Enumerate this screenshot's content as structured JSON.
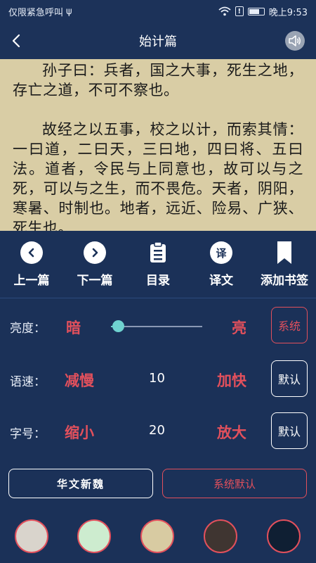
{
  "status_bar": {
    "carrier": "仅限紧急呼叫",
    "usb": "ψ",
    "signal": "!",
    "time": "晚上9:53"
  },
  "nav": {
    "title": "始计篇"
  },
  "text": {
    "paragraphs": [
      "孙子曰：兵者，国之大事，死生之地，存亡之道，不可不察也。",
      "故经之以五事，校之以计，而索其情：一曰道，二曰天，三曰地，四曰将、五曰法。道者，令民与上同意也，故可以与之死，可以与之生，而不畏危。天者，阴阳，寒暑、时制也。地者，远近、险易、广狭、死生也。"
    ]
  },
  "toolbar": {
    "items": [
      {
        "label": "上一篇",
        "icon": "prev-arrow-icon"
      },
      {
        "label": "下一篇",
        "icon": "next-arrow-icon"
      },
      {
        "label": "目录",
        "icon": "list-icon",
        "glyph": ""
      },
      {
        "label": "译文",
        "icon": "translate-icon",
        "glyph": "译"
      },
      {
        "label": "添加书签",
        "icon": "bookmark-icon"
      }
    ]
  },
  "settings": {
    "brightness": {
      "label": "亮度：",
      "low": "暗",
      "high": "亮",
      "button": "系统",
      "level": 0.08
    },
    "speed": {
      "label": "语速：",
      "dec": "减慢",
      "value": "10",
      "inc": "加快",
      "button": "默认"
    },
    "font_size": {
      "label": "字号：",
      "dec": "缩小",
      "value": "20",
      "inc": "放大",
      "button": "默认"
    }
  },
  "fonts": {
    "current": "华文新魏",
    "default": "系统默认"
  },
  "colors": {
    "accent": "#e2505c",
    "background": "#1b3158",
    "page": "#d9cda5",
    "swatches": [
      "#d9d4cc",
      "#cdeccf",
      "#d8cba2",
      "#3f3531",
      "#0f1f33"
    ]
  }
}
